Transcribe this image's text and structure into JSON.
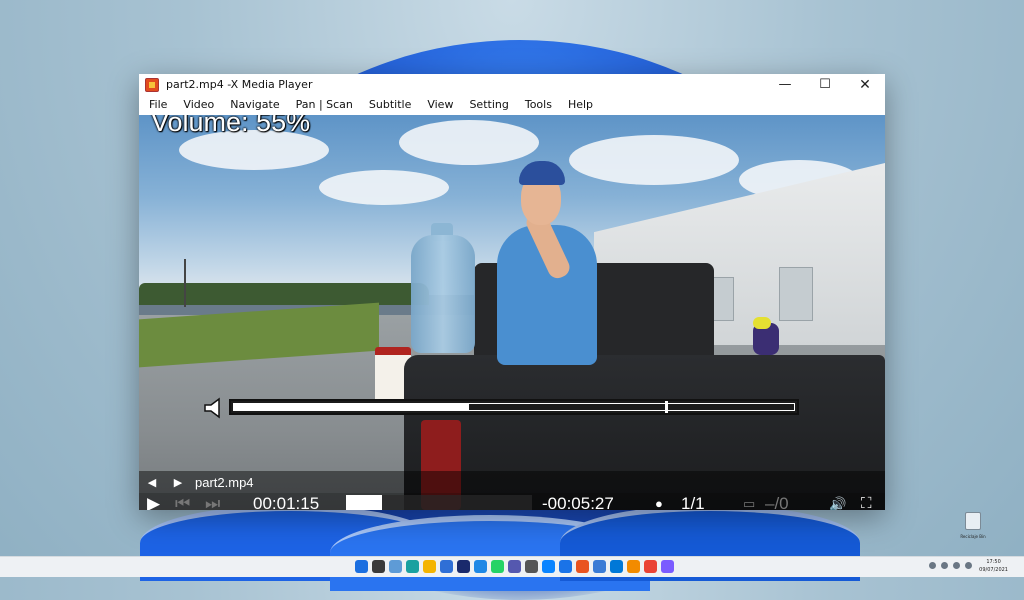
{
  "window": {
    "title": "part2.mp4 -X Media Player",
    "controls": {
      "minimize": "—",
      "maximize": "☐",
      "close": "✕"
    }
  },
  "menu": [
    {
      "label": "File"
    },
    {
      "label": "Video"
    },
    {
      "label": "Navigate"
    },
    {
      "label": "Pan | Scan"
    },
    {
      "label": "Subtitle"
    },
    {
      "label": "View"
    },
    {
      "label": "Setting"
    },
    {
      "label": "Tools"
    },
    {
      "label": "Help"
    }
  ],
  "osd": {
    "volume_text": "Volume: 55%",
    "volume_level": 0.42,
    "volume_marker": 0.77
  },
  "playlist": {
    "prev_icon": "◀",
    "next_icon": "▶",
    "current_file": "part2.mp4"
  },
  "controls": {
    "play_icon": "▶",
    "prev_track_icon": "⏮",
    "next_track_icon": "⏭",
    "elapsed": "00:01:15",
    "remaining": "-00:05:27",
    "subtitle_icon": "●",
    "subtitle_track": "1/1",
    "audio_track": "–/0",
    "volume_icon": "🔊",
    "fullscreen_icon": "⛶"
  },
  "desktop": {
    "recycle_label": "Reciclaje Bin"
  },
  "taskbar": {
    "time": "17:50",
    "date": "09/07/2021",
    "icon_colors": [
      "#1b6fe0",
      "#3a3a3a",
      "#5e9bd6",
      "#1aa1a0",
      "#f4b400",
      "#2f6fd6",
      "#1a2a6c",
      "#1e88e5",
      "#25d366",
      "#5558af",
      "#555555",
      "#0a84ff",
      "#1a73e8",
      "#e95420",
      "#3a7bd5",
      "#0078d7",
      "#f28b00",
      "#ea4335",
      "#7b5cff"
    ]
  }
}
